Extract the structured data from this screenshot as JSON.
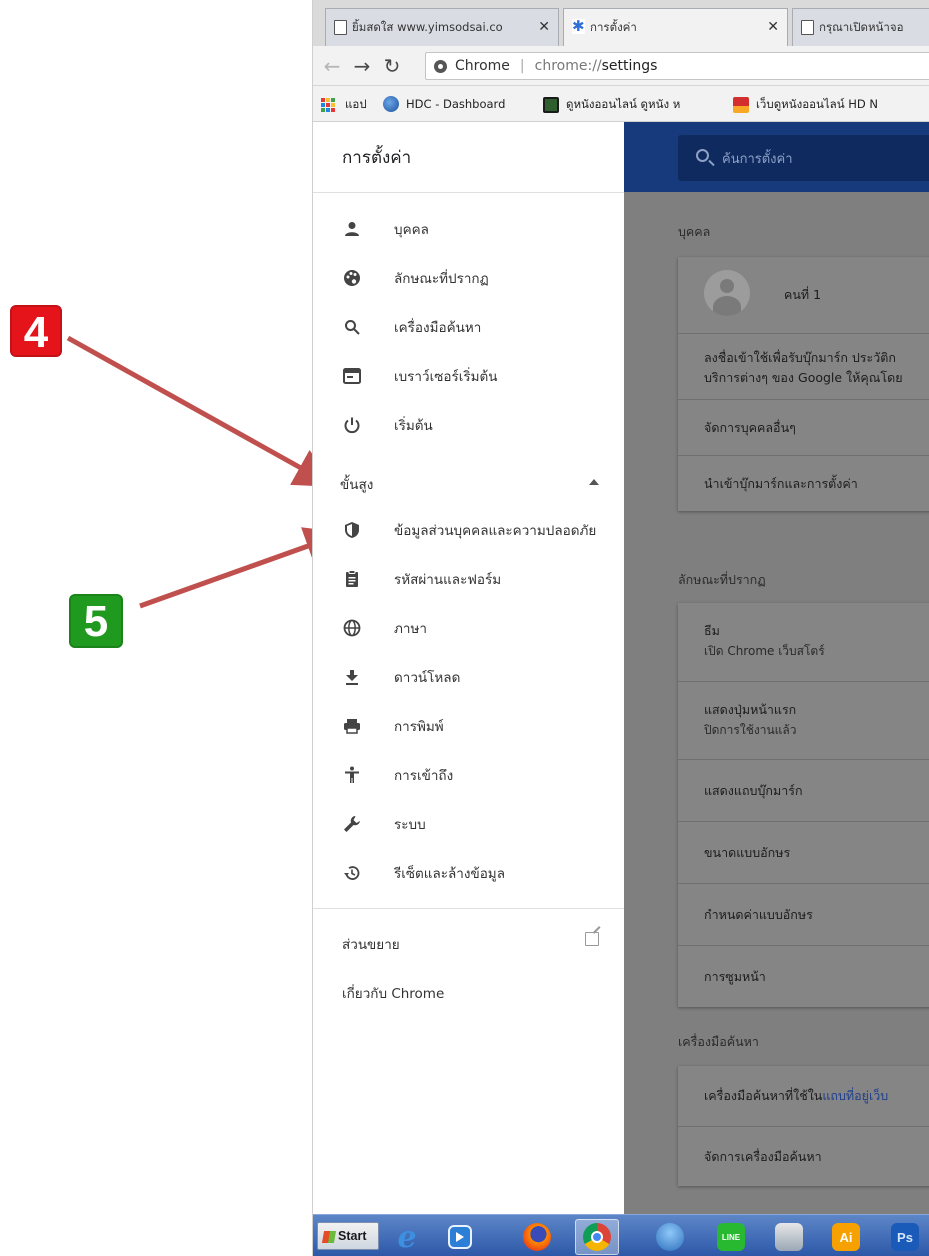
{
  "annotations": {
    "step_4": "4",
    "step_5": "5"
  },
  "tabs": [
    {
      "title": "ยิ้มสดใส www.yimsodsai.co",
      "close": "✕"
    },
    {
      "title": "การตั้งค่า",
      "close": "✕"
    },
    {
      "title": "กรุณาเปิดหน้าจอ",
      "close": ""
    }
  ],
  "omnibox": {
    "chip_label": "Chrome",
    "url_prefix": "chrome://",
    "url_path": "settings"
  },
  "bookmarks": [
    {
      "label": "แอป"
    },
    {
      "label": "HDC - Dashboard"
    },
    {
      "label": "ดูหนังออนไลน์ ดูหนัง ห"
    },
    {
      "label": "เว็บดูหนังออนไลน์ HD N"
    }
  ],
  "sidebar": {
    "title": "การตั้งค่า",
    "items": [
      {
        "label": "บุคคล",
        "icon": "person-icon"
      },
      {
        "label": "ลักษณะที่ปรากฏ",
        "icon": "palette-icon"
      },
      {
        "label": "เครื่องมือค้นหา",
        "icon": "search-icon"
      },
      {
        "label": "เบราว์เซอร์เริ่มต้น",
        "icon": "browser-window-icon"
      },
      {
        "label": "เริ่มต้น",
        "icon": "power-icon"
      }
    ],
    "advanced_label": "ขั้นสูง",
    "advanced_items": [
      {
        "label": "ข้อมูลส่วนบุคคลและความปลอดภัย",
        "icon": "shield-icon"
      },
      {
        "label": "รหัสผ่านและฟอร์ม",
        "icon": "clipboard-icon"
      },
      {
        "label": "ภาษา",
        "icon": "globe-icon"
      },
      {
        "label": "ดาวน์โหลด",
        "icon": "download-icon"
      },
      {
        "label": "การพิมพ์",
        "icon": "printer-icon"
      },
      {
        "label": "การเข้าถึง",
        "icon": "accessibility-icon"
      },
      {
        "label": "ระบบ",
        "icon": "wrench-icon"
      },
      {
        "label": "รีเซ็ตและล้างข้อมูล",
        "icon": "restore-icon"
      }
    ],
    "extensions_label": "ส่วนขยาย",
    "about_label": "เกี่ยวกับ Chrome"
  },
  "main": {
    "search_placeholder": "ค้นการตั้งค่า",
    "people": {
      "section_title": "บุคคล",
      "profile_name": "คนที่ 1",
      "signin_line1": "ลงชื่อเข้าใช้เพื่อรับบุ๊กมาร์ก ประวัติก",
      "signin_line2": "บริการต่างๆ ของ Google ให้คุณโดย",
      "manage_people": "จัดการบุคคลอื่นๆ",
      "import": "นำเข้าบุ๊กมาร์กและการตั้งค่า"
    },
    "appearance": {
      "section_title": "ลักษณะที่ปรากฏ",
      "theme_label": "ธีม",
      "theme_sub": "เปิด Chrome เว็บสโตร์",
      "home_label": "แสดงปุ่มหน้าแรก",
      "home_sub": "ปิดการใช้งานแล้ว",
      "bookmarks_bar": "แสดงแถบบุ๊กมาร์ก",
      "font_size": "ขนาดแบบอักษร",
      "customize_fonts": "กำหนดค่าแบบอักษร",
      "zoom": "การซูมหน้า"
    },
    "search_engine": {
      "section_title": "เครื่องมือค้นหา",
      "used_label": "เครื่องมือค้นหาที่ใช้ใน",
      "used_link": "แถบที่อยู่เว็บ",
      "manage": "จัดการเครื่องมือค้นหา"
    }
  },
  "taskbar": {
    "start_label": "Start",
    "apps": [
      {
        "name": "ie-icon",
        "label": "e"
      },
      {
        "name": "media-player-icon",
        "label": ""
      },
      {
        "name": "firefox-icon",
        "label": ""
      },
      {
        "name": "chrome-icon",
        "label": ""
      },
      {
        "name": "thunderbird-icon",
        "label": ""
      },
      {
        "name": "line-icon",
        "label": "LINE"
      },
      {
        "name": "scanner-icon",
        "label": ""
      },
      {
        "name": "illustrator-icon",
        "label": "Ai"
      },
      {
        "name": "photoshop-icon",
        "label": "Ps"
      }
    ]
  },
  "colors": {
    "annotation_red": "#e5141b",
    "annotation_green": "#1f9a1f",
    "arrow": "#c0504d",
    "settings_header": "#173a7d",
    "overlay": "#7f7f7f"
  }
}
